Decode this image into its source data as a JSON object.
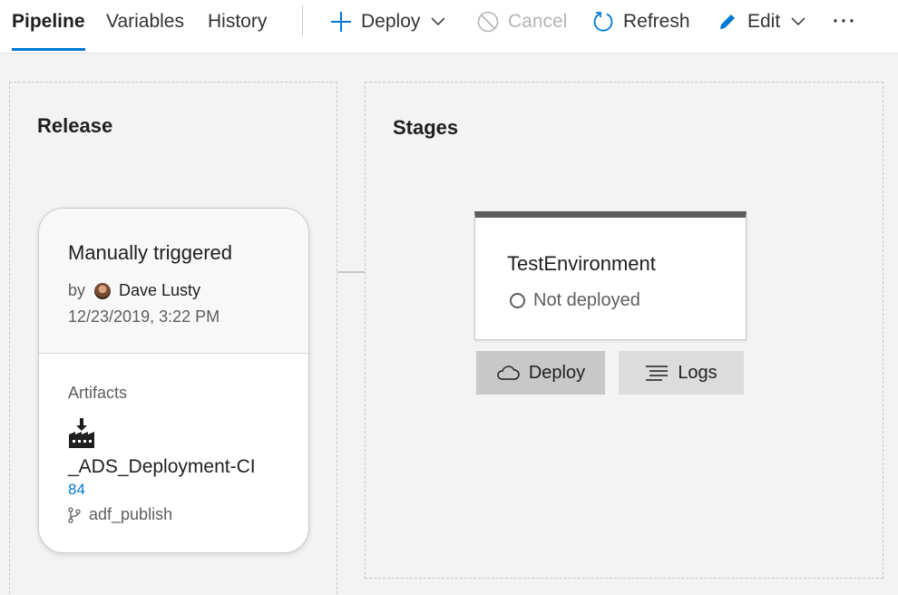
{
  "tabs": [
    {
      "label": "Pipeline",
      "active": true
    },
    {
      "label": "Variables",
      "active": false
    },
    {
      "label": "History",
      "active": false
    }
  ],
  "toolbar": {
    "deploy_label": "Deploy",
    "cancel_label": "Cancel",
    "refresh_label": "Refresh",
    "edit_label": "Edit",
    "more_label": "···"
  },
  "release_panel": {
    "title": "Release",
    "trigger": "Manually triggered",
    "by_label": "by",
    "author": "Dave Lusty",
    "timestamp": "12/23/2019, 3:22 PM",
    "artifacts_label": "Artifacts",
    "artifact_name": "_ADS_Deployment-CI",
    "artifact_build": "84",
    "artifact_branch": "adf_publish"
  },
  "stages_panel": {
    "title": "Stages",
    "stage_name": "TestEnvironment",
    "stage_status": "Not deployed",
    "deploy_button": "Deploy",
    "logs_button": "Logs"
  },
  "colors": {
    "accent": "#0078d4",
    "stage_bar": "#5c5c5c",
    "disabled": "#b4b4b4"
  }
}
